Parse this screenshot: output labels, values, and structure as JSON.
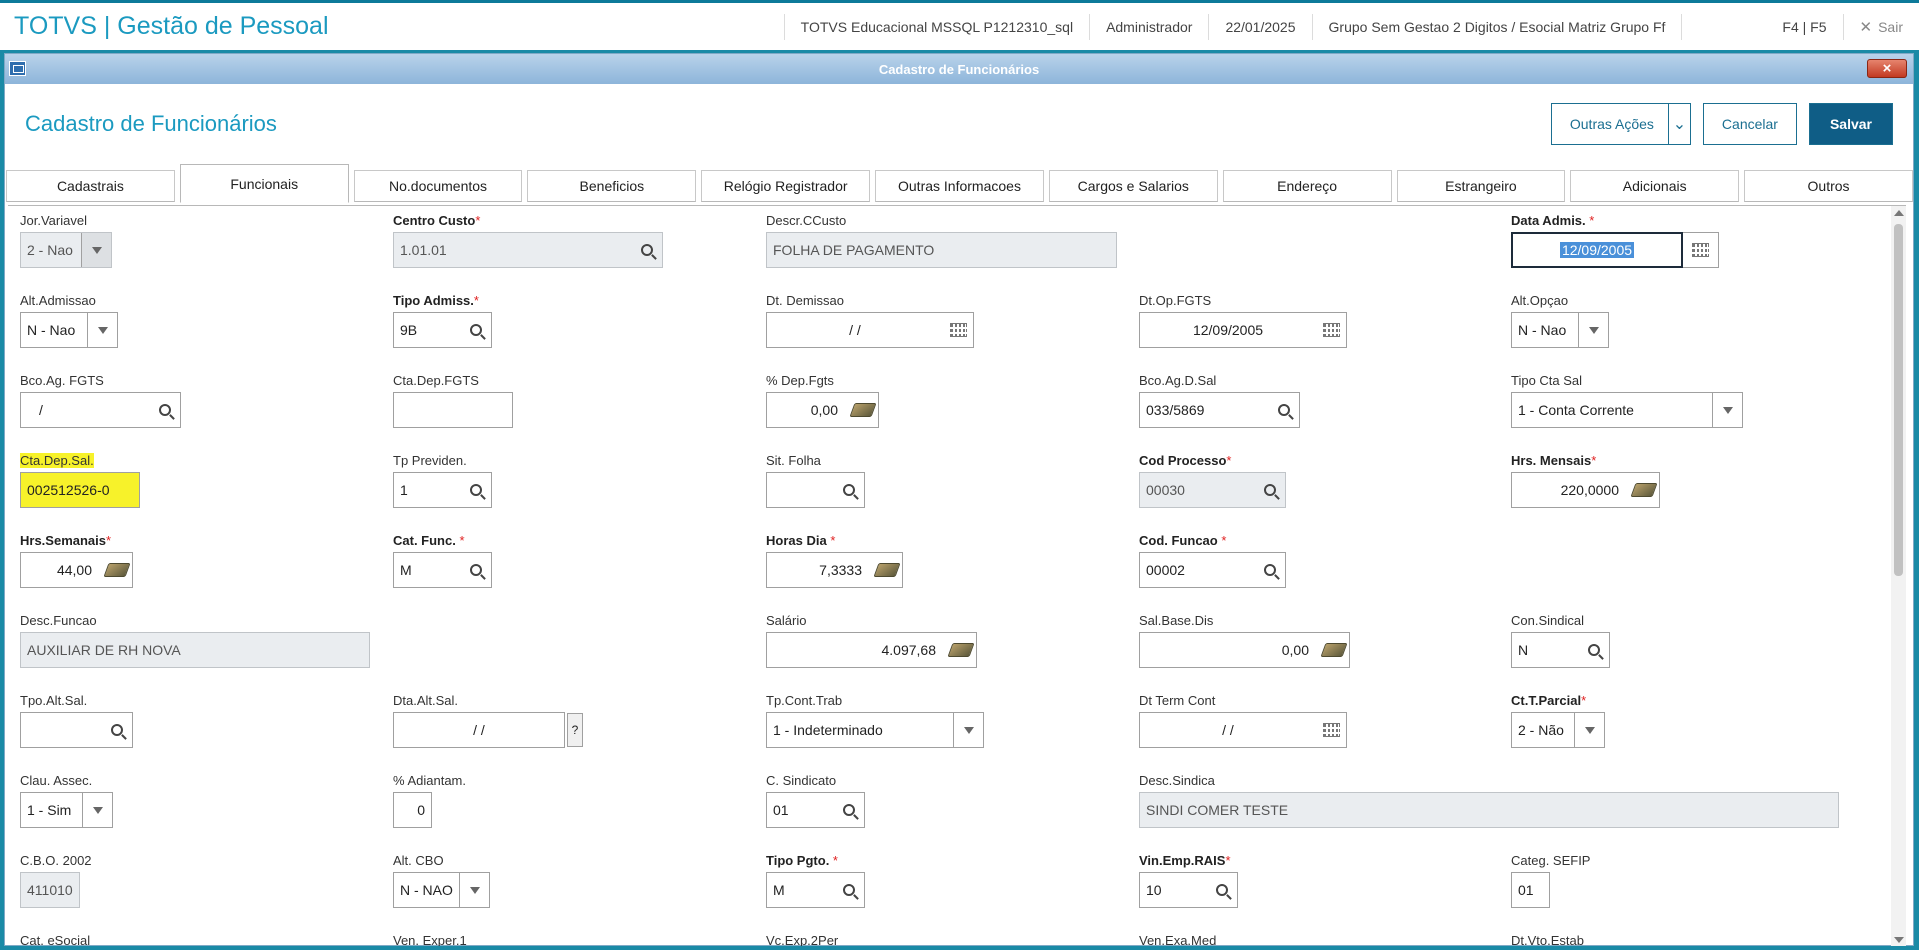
{
  "app": {
    "brand": "TOTVS | Gestão de Pessoal",
    "environment": "TOTVS Educacional MSSQL P1212310_sql",
    "user": "Administrador",
    "date": "22/01/2025",
    "company": "Grupo Sem Gestao 2 Digitos / Esocial Matriz Grupo Ff",
    "shortcuts": "F4 | F5",
    "exit_label": "Sair",
    "accent": "#1b9ac0"
  },
  "window": {
    "title": "Cadastro de Funcionários",
    "close": "×"
  },
  "page": {
    "title": "Cadastro de Funcionários",
    "actions_label": "Outras Ações",
    "cancel_label": "Cancelar",
    "save_label": "Salvar"
  },
  "tabs": [
    {
      "label": "Cadastrais",
      "active": false
    },
    {
      "label": "Funcionais",
      "active": true
    },
    {
      "label": "No.documentos",
      "active": false
    },
    {
      "label": "Beneficios",
      "active": false
    },
    {
      "label": "Relógio Registrador",
      "active": false
    },
    {
      "label": "Outras Informacoes",
      "active": false
    },
    {
      "label": "Cargos e Salarios",
      "active": false
    },
    {
      "label": "Endereço",
      "active": false
    },
    {
      "label": "Estrangeiro",
      "active": false
    },
    {
      "label": "Adicionais",
      "active": false
    },
    {
      "label": "Outros",
      "active": false
    }
  ],
  "form": {
    "jor_variavel": {
      "label": "Jor.Variavel",
      "value": "2 - Nao"
    },
    "centro_custo": {
      "label": "Centro Custo",
      "value": "1.01.01"
    },
    "descr_ccusto": {
      "label": "Descr.CCusto",
      "value": "FOLHA DE PAGAMENTO"
    },
    "data_admis": {
      "label": "Data Admis. ",
      "value": "12/09/2005"
    },
    "alt_admissao": {
      "label": "Alt.Admissao",
      "value": "N - Nao"
    },
    "tipo_admiss": {
      "label": "Tipo Admiss.",
      "value": "9B"
    },
    "dt_demissao": {
      "label": "Dt. Demissao",
      "value": "/  /"
    },
    "dt_op_fgts": {
      "label": "Dt.Op.FGTS",
      "value": "12/09/2005"
    },
    "alt_opcao": {
      "label": "Alt.Opçao",
      "value": "N - Nao"
    },
    "bco_ag_fgts": {
      "label": "Bco.Ag. FGTS",
      "value": "/"
    },
    "cta_dep_fgts": {
      "label": "Cta.Dep.FGTS",
      "value": ""
    },
    "pct_dep_fgts": {
      "label": "% Dep.Fgts",
      "value": "0,00"
    },
    "bco_ag_d_sal": {
      "label": "Bco.Ag.D.Sal",
      "value": "033/5869"
    },
    "tipo_cta_sal": {
      "label": "Tipo Cta Sal",
      "value": "1 - Conta Corrente"
    },
    "cta_dep_sal": {
      "label": "Cta.Dep.Sal.",
      "value": "002512526-0"
    },
    "tp_previden": {
      "label": "Tp Previden.",
      "value": "1"
    },
    "sit_folha": {
      "label": "Sit. Folha",
      "value": ""
    },
    "cod_processo": {
      "label": "Cod Processo",
      "value": "00030"
    },
    "hrs_mensais": {
      "label": "Hrs. Mensais",
      "value": "220,0000"
    },
    "hrs_semanais": {
      "label": "Hrs.Semanais",
      "value": "44,00"
    },
    "cat_func": {
      "label": "Cat. Func. ",
      "value": "M"
    },
    "horas_dia": {
      "label": "Horas Dia ",
      "value": "7,3333"
    },
    "cod_funcao": {
      "label": "Cod. Funcao ",
      "value": "00002"
    },
    "desc_funcao": {
      "label": "Desc.Funcao",
      "value": "AUXILIAR DE RH NOVA"
    },
    "salario": {
      "label": "Salário",
      "value": "4.097,68"
    },
    "sal_base_dis": {
      "label": "Sal.Base.Dis",
      "value": "0,00"
    },
    "con_sindical": {
      "label": "Con.Sindical",
      "value": "N"
    },
    "tpo_alt_sal": {
      "label": "Tpo.Alt.Sal.",
      "value": ""
    },
    "dta_alt_sal": {
      "label": "Dta.Alt.Sal.",
      "value": "/  /",
      "help": "?"
    },
    "tp_cont_trab": {
      "label": "Tp.Cont.Trab",
      "value": "1 - Indeterminado"
    },
    "dt_term_cont": {
      "label": "Dt Term Cont",
      "value": "/  /"
    },
    "ct_t_parcial": {
      "label": "Ct.T.Parcial",
      "value": "2 - Não"
    },
    "clau_assec": {
      "label": "Clau. Assec.",
      "value": "1 - Sim"
    },
    "pct_adiantam": {
      "label": "% Adiantam.",
      "value": "0"
    },
    "c_sindicato": {
      "label": "C. Sindicato",
      "value": "01"
    },
    "desc_sindica": {
      "label": "Desc.Sindica",
      "value": "SINDI COMER TESTE"
    },
    "cbo_2002": {
      "label": "C.B.O. 2002",
      "value": "411010"
    },
    "alt_cbo": {
      "label": "Alt. CBO",
      "value": "N - NAO"
    },
    "tipo_pgto": {
      "label": "Tipo Pgto. ",
      "value": "M"
    },
    "vin_emp_rais": {
      "label": "Vin.Emp.RAIS",
      "value": "10"
    },
    "categ_sefip": {
      "label": "Categ. SEFIP",
      "value": "01"
    },
    "cat_esocial": {
      "label": "Cat. eSocial"
    },
    "ven_exper1": {
      "label": "Ven. Exper.1"
    },
    "vc_exp_2per": {
      "label": "Vc.Exp.2Per"
    },
    "ven_exa_med": {
      "label": "Ven.Exa.Med"
    },
    "dt_vto_estab": {
      "label": "Dt.Vto.Estab"
    }
  }
}
